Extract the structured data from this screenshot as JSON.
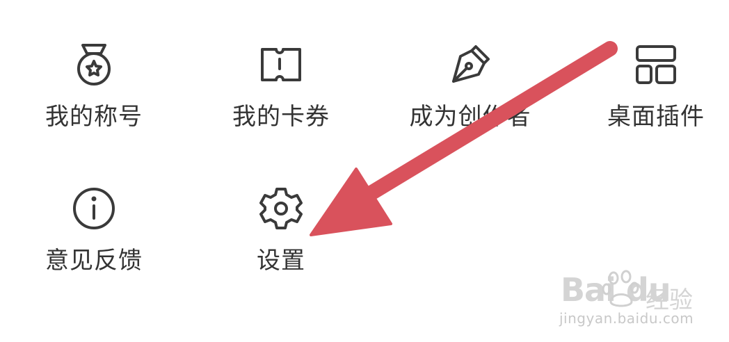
{
  "menu": {
    "items": [
      {
        "label": "我的称号",
        "icon": "medal-icon"
      },
      {
        "label": "我的卡券",
        "icon": "ticket-icon"
      },
      {
        "label": "成为创作者",
        "icon": "pen-nib-icon"
      },
      {
        "label": "桌面插件",
        "icon": "widget-icon"
      },
      {
        "label": "意见反馈",
        "icon": "info-icon"
      },
      {
        "label": "设置",
        "icon": "gear-icon"
      }
    ]
  },
  "annotation": {
    "arrow_color": "#d9525c",
    "points_to": "设置"
  },
  "watermark": {
    "logo": "Bai  du",
    "brand": "经验",
    "url": "jingyan.baidu.com"
  },
  "colors": {
    "icon_stroke": "#3a3a3a",
    "label_text": "#333333",
    "background": "#ffffff"
  }
}
